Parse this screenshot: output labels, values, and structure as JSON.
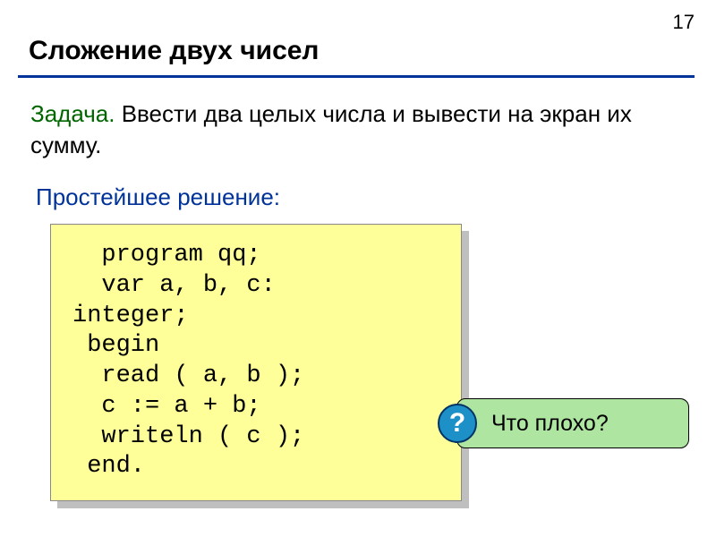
{
  "page_number": "17",
  "title": "Сложение двух чисел",
  "task": {
    "label": "Задача.",
    "text": "Ввести два целых числа и вывести на экран их сумму."
  },
  "subheading": "Простейшее решение:",
  "code": "  program qq;\n  var a, b, c:\ninteger;\n begin\n  read ( a, b );\n  c := a + b;\n  writeln ( c );\n end.",
  "callout": {
    "icon": "?",
    "text": "Что плохо?"
  }
}
